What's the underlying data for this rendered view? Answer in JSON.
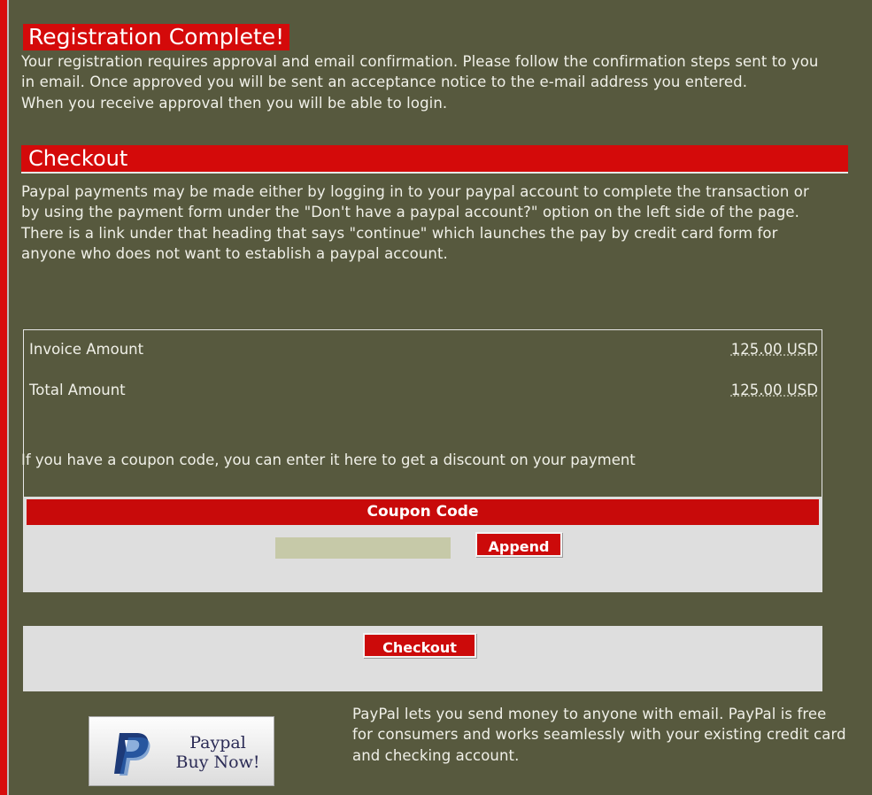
{
  "registration": {
    "title": "Registration Complete!",
    "message": " Your registration requires approval and email confirmation. Please follow the confirmation steps sent to you in email. Once approved you will be sent an acceptance notice to the e-mail address you entered.",
    "message2": " When you receive approval then you will be able to login."
  },
  "checkout": {
    "title": "Checkout",
    "paypal_message": "Paypal payments may be made either by logging in to your paypal account to complete the transaction or by using the payment form under the \"Don't have a paypal account?\" option on the left side of the page. There is a link under that heading that says \"continue\" which launches the pay by credit card form for anyone who does not want to establish a paypal account."
  },
  "invoice": {
    "invoice_label": "Invoice Amount",
    "invoice_value": "125.00 USD",
    "total_label": "Total Amount",
    "total_value": "125.00 USD",
    "coupon_note": "If you have a coupon code, you can enter it here to get a discount on your payment"
  },
  "coupon": {
    "header": "Coupon Code",
    "input_value": "",
    "append_label": "Append"
  },
  "checkout_button": {
    "label": "Checkout"
  },
  "paypal": {
    "badge_line1": "Paypal",
    "badge_line2": "Buy Now!",
    "description": "PayPal lets you send money to anyone with email. PayPal is free for consumers and works seamlessly with your existing credit card and checking account."
  },
  "colors": {
    "background": "#57593e",
    "accent_red": "#d40a0a",
    "panel_gray": "#dedede",
    "input_fill": "#c6c9a8"
  }
}
